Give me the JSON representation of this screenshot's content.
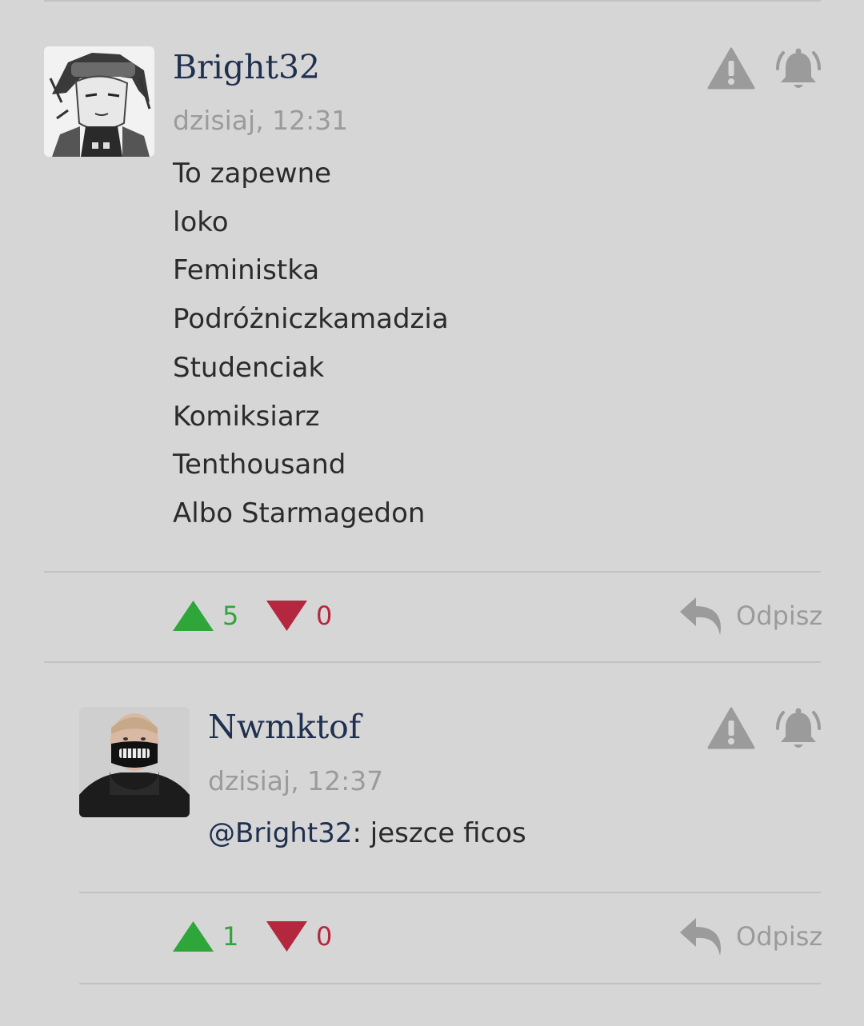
{
  "colors": {
    "background": "#d6d6d6",
    "username": "#20304f",
    "timestamp": "#9b9b9b",
    "upvote": "#2fa63a",
    "downvote": "#b3283e",
    "icon": "#9b9b9b"
  },
  "comments": [
    {
      "username": "Bright32",
      "timestamp": "dzisiaj, 12:31",
      "lines": [
        "To zapewne",
        "loko",
        "Feministka",
        "Podróżniczkamadzia",
        "Studenciak",
        "Komiksiarz",
        "Tenthousand",
        "Albo Starmagedon"
      ],
      "upvotes": "5",
      "downvotes": "0",
      "reply_label": "Odpisz",
      "icons": [
        "warning-icon",
        "bell-icon"
      ]
    },
    {
      "username": "Nwmktof",
      "timestamp": "dzisiaj, 12:37",
      "mention": "@Bright32",
      "text": ": jeszce ficos",
      "upvotes": "1",
      "downvotes": "0",
      "reply_label": "Odpisz",
      "icons": [
        "warning-icon",
        "bell-icon"
      ]
    }
  ]
}
